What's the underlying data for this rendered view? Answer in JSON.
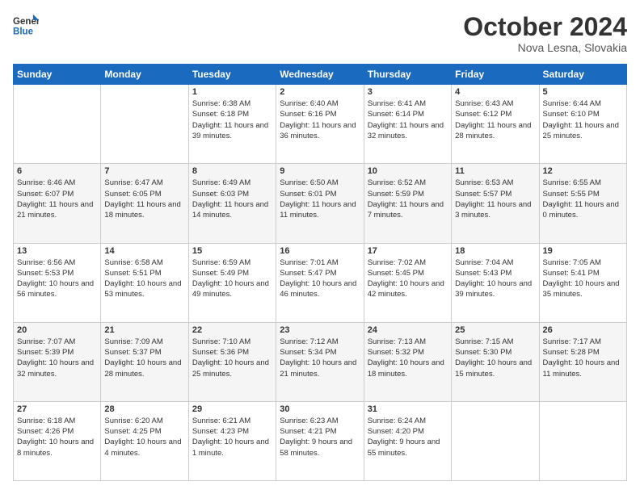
{
  "logo": {
    "line1": "General",
    "line2": "Blue"
  },
  "header": {
    "month": "October 2024",
    "location": "Nova Lesna, Slovakia"
  },
  "weekdays": [
    "Sunday",
    "Monday",
    "Tuesday",
    "Wednesday",
    "Thursday",
    "Friday",
    "Saturday"
  ],
  "weeks": [
    [
      {
        "day": "",
        "text": ""
      },
      {
        "day": "",
        "text": ""
      },
      {
        "day": "1",
        "text": "Sunrise: 6:38 AM\nSunset: 6:18 PM\nDaylight: 11 hours and 39 minutes."
      },
      {
        "day": "2",
        "text": "Sunrise: 6:40 AM\nSunset: 6:16 PM\nDaylight: 11 hours and 36 minutes."
      },
      {
        "day": "3",
        "text": "Sunrise: 6:41 AM\nSunset: 6:14 PM\nDaylight: 11 hours and 32 minutes."
      },
      {
        "day": "4",
        "text": "Sunrise: 6:43 AM\nSunset: 6:12 PM\nDaylight: 11 hours and 28 minutes."
      },
      {
        "day": "5",
        "text": "Sunrise: 6:44 AM\nSunset: 6:10 PM\nDaylight: 11 hours and 25 minutes."
      }
    ],
    [
      {
        "day": "6",
        "text": "Sunrise: 6:46 AM\nSunset: 6:07 PM\nDaylight: 11 hours and 21 minutes."
      },
      {
        "day": "7",
        "text": "Sunrise: 6:47 AM\nSunset: 6:05 PM\nDaylight: 11 hours and 18 minutes."
      },
      {
        "day": "8",
        "text": "Sunrise: 6:49 AM\nSunset: 6:03 PM\nDaylight: 11 hours and 14 minutes."
      },
      {
        "day": "9",
        "text": "Sunrise: 6:50 AM\nSunset: 6:01 PM\nDaylight: 11 hours and 11 minutes."
      },
      {
        "day": "10",
        "text": "Sunrise: 6:52 AM\nSunset: 5:59 PM\nDaylight: 11 hours and 7 minutes."
      },
      {
        "day": "11",
        "text": "Sunrise: 6:53 AM\nSunset: 5:57 PM\nDaylight: 11 hours and 3 minutes."
      },
      {
        "day": "12",
        "text": "Sunrise: 6:55 AM\nSunset: 5:55 PM\nDaylight: 11 hours and 0 minutes."
      }
    ],
    [
      {
        "day": "13",
        "text": "Sunrise: 6:56 AM\nSunset: 5:53 PM\nDaylight: 10 hours and 56 minutes."
      },
      {
        "day": "14",
        "text": "Sunrise: 6:58 AM\nSunset: 5:51 PM\nDaylight: 10 hours and 53 minutes."
      },
      {
        "day": "15",
        "text": "Sunrise: 6:59 AM\nSunset: 5:49 PM\nDaylight: 10 hours and 49 minutes."
      },
      {
        "day": "16",
        "text": "Sunrise: 7:01 AM\nSunset: 5:47 PM\nDaylight: 10 hours and 46 minutes."
      },
      {
        "day": "17",
        "text": "Sunrise: 7:02 AM\nSunset: 5:45 PM\nDaylight: 10 hours and 42 minutes."
      },
      {
        "day": "18",
        "text": "Sunrise: 7:04 AM\nSunset: 5:43 PM\nDaylight: 10 hours and 39 minutes."
      },
      {
        "day": "19",
        "text": "Sunrise: 7:05 AM\nSunset: 5:41 PM\nDaylight: 10 hours and 35 minutes."
      }
    ],
    [
      {
        "day": "20",
        "text": "Sunrise: 7:07 AM\nSunset: 5:39 PM\nDaylight: 10 hours and 32 minutes."
      },
      {
        "day": "21",
        "text": "Sunrise: 7:09 AM\nSunset: 5:37 PM\nDaylight: 10 hours and 28 minutes."
      },
      {
        "day": "22",
        "text": "Sunrise: 7:10 AM\nSunset: 5:36 PM\nDaylight: 10 hours and 25 minutes."
      },
      {
        "day": "23",
        "text": "Sunrise: 7:12 AM\nSunset: 5:34 PM\nDaylight: 10 hours and 21 minutes."
      },
      {
        "day": "24",
        "text": "Sunrise: 7:13 AM\nSunset: 5:32 PM\nDaylight: 10 hours and 18 minutes."
      },
      {
        "day": "25",
        "text": "Sunrise: 7:15 AM\nSunset: 5:30 PM\nDaylight: 10 hours and 15 minutes."
      },
      {
        "day": "26",
        "text": "Sunrise: 7:17 AM\nSunset: 5:28 PM\nDaylight: 10 hours and 11 minutes."
      }
    ],
    [
      {
        "day": "27",
        "text": "Sunrise: 6:18 AM\nSunset: 4:26 PM\nDaylight: 10 hours and 8 minutes."
      },
      {
        "day": "28",
        "text": "Sunrise: 6:20 AM\nSunset: 4:25 PM\nDaylight: 10 hours and 4 minutes."
      },
      {
        "day": "29",
        "text": "Sunrise: 6:21 AM\nSunset: 4:23 PM\nDaylight: 10 hours and 1 minute."
      },
      {
        "day": "30",
        "text": "Sunrise: 6:23 AM\nSunset: 4:21 PM\nDaylight: 9 hours and 58 minutes."
      },
      {
        "day": "31",
        "text": "Sunrise: 6:24 AM\nSunset: 4:20 PM\nDaylight: 9 hours and 55 minutes."
      },
      {
        "day": "",
        "text": ""
      },
      {
        "day": "",
        "text": ""
      }
    ]
  ]
}
